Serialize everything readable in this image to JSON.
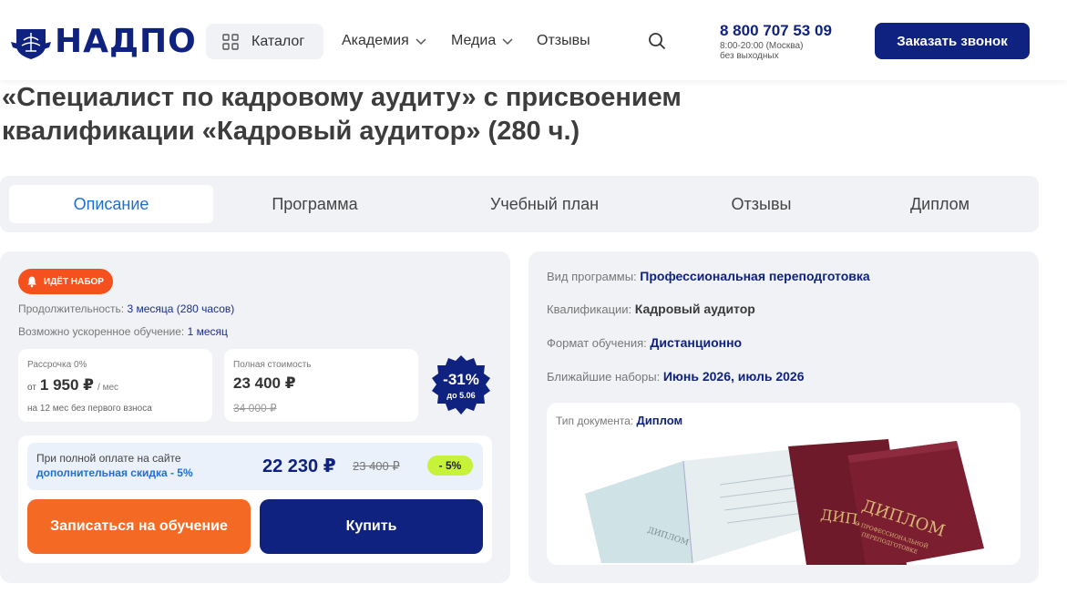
{
  "header": {
    "logo_text": "НАДПО",
    "catalog_label": "Каталог",
    "nav": [
      {
        "label": "Академия",
        "has_dropdown": true
      },
      {
        "label": "Медиа",
        "has_dropdown": true
      },
      {
        "label": "Отзывы",
        "has_dropdown": false
      }
    ],
    "phone": "8 800 707 53 09",
    "hours_line1": "8:00-20:00 (Москва)",
    "hours_line2": "без выходных",
    "call_button": "Заказать звонок"
  },
  "title": {
    "line1": "«Специалист по кадровому аудиту» с присвоением",
    "line2": "квалификации «Кадровый аудитор» (280 ч.)"
  },
  "tabs": [
    {
      "label": "Описание",
      "active": true
    },
    {
      "label": "Программа",
      "active": false
    },
    {
      "label": "Учебный план",
      "active": false
    },
    {
      "label": "Отзывы",
      "active": false
    },
    {
      "label": "Диплом",
      "active": false
    }
  ],
  "offer": {
    "badge": "ИДЁТ НАБОР",
    "duration_label": "Продолжительность:",
    "duration_value": "3 месяца (280 часов)",
    "fast_label": "Возможно ускоренное обучение:",
    "fast_value": "1 месяц",
    "installment": {
      "label": "Рассрочка 0%",
      "prefix": "от",
      "amount": "1 950 ₽",
      "suffix": "/ мес",
      "note": "на 12 мес без первого взноса"
    },
    "full_price": {
      "label": "Полная стоимость",
      "price": "23 400 ₽",
      "old_price": "34 000 ₽"
    },
    "discount": {
      "percent": "-31%",
      "until": "до 5.06"
    },
    "online": {
      "line1": "При полной оплате на сайте",
      "line2": "дополнительная скидка - 5%",
      "price": "22 230 ₽",
      "old_price": "23 400 ₽",
      "badge": "- 5%"
    },
    "enroll_button": "Записаться на обучение",
    "buy_button": "Купить"
  },
  "details": {
    "program_type_label": "Вид программы:",
    "program_type_value": "Профессиональная переподготовка",
    "qualification_label": "Квалификации:",
    "qualification_value": "Кадровый аудитор",
    "format_label": "Формат обучения:",
    "format_value": "Дистанционно",
    "next_label": "Ближайшие наборы:",
    "next_value": "Июнь 2026, июль 2026",
    "doc_type_label": "Тип документа:",
    "doc_type_value": "Диплом",
    "diploma_cover_text_big": "ДИПЛОМ",
    "diploma_cover_text_small1": "О ПРОФЕССИОНАЛЬНОЙ",
    "diploma_cover_text_small2": "ПЕРЕПОДГОТОВКЕ",
    "diploma_back_text": "ДИПЛ",
    "diploma_sheet_text": "ДИПЛОМ"
  },
  "colors": {
    "brand_blue": "#0f2280",
    "accent_orange": "#f46a25",
    "badge_red": "#f4511e",
    "tab_active": "#1f6ed4",
    "discount_green": "#c6f23a"
  }
}
